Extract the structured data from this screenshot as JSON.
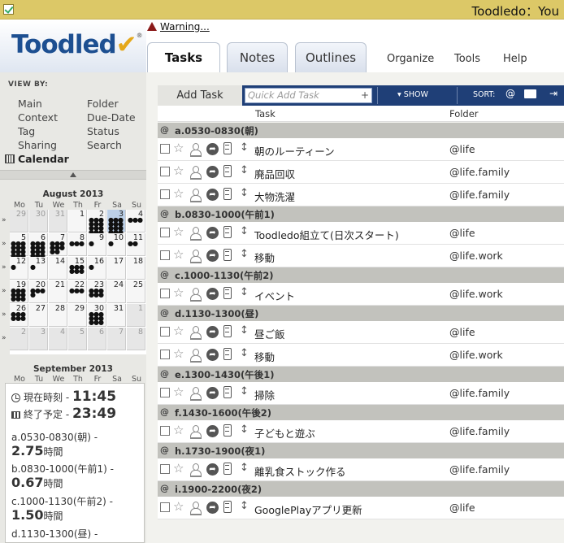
{
  "window": {
    "title": "Toodledo：You"
  },
  "logo": {
    "text": "Toodled",
    "check": "✔",
    "reg": "®"
  },
  "warning": {
    "label": "Warning..."
  },
  "tabs": [
    {
      "label": "Tasks",
      "active": true
    },
    {
      "label": "Notes",
      "active": false
    },
    {
      "label": "Outlines",
      "active": false
    }
  ],
  "nav": [
    "Organize",
    "Tools",
    "Help"
  ],
  "viewby": {
    "title": "VIEW BY:",
    "left": [
      "Main",
      "Context",
      "Tag",
      "Sharing",
      "Calendar"
    ],
    "right": [
      "Folder",
      "Due-Date",
      "Status",
      "Search"
    ]
  },
  "calendar": {
    "month1": "August 2013",
    "month2": "September 2013",
    "dow": [
      "Mo",
      "Tu",
      "We",
      "Th",
      "Fr",
      "Sa",
      "Su"
    ],
    "weeks": [
      [
        {
          "d": "29",
          "o": true,
          "dots": ""
        },
        {
          "d": "30",
          "o": true,
          "dots": ""
        },
        {
          "d": "31",
          "o": true,
          "dots": ""
        },
        {
          "d": "1",
          "o": false,
          "dots": ""
        },
        {
          "d": "2",
          "o": false,
          "dots": "●●●●●●●●●●●●"
        },
        {
          "d": "3",
          "o": false,
          "sel": true,
          "dots": "●●●●●●●●●●●●"
        },
        {
          "d": "4",
          "o": false,
          "dots": "●●●"
        }
      ],
      [
        {
          "d": "5",
          "o": false,
          "dots": "●●●●●●●●●●●●"
        },
        {
          "d": "6",
          "o": false,
          "dots": "●●●●●●●●●●●●"
        },
        {
          "d": "7",
          "o": false,
          "dots": "●●●●●●●●"
        },
        {
          "d": "8",
          "o": false,
          "dots": "●●●"
        },
        {
          "d": "9",
          "o": false,
          "dots": "●"
        },
        {
          "d": "10",
          "o": false,
          "dots": "●"
        },
        {
          "d": "11",
          "o": false,
          "dots": "●●"
        }
      ],
      [
        {
          "d": "12",
          "o": false,
          "dots": "●"
        },
        {
          "d": "13",
          "o": false,
          "dots": "●"
        },
        {
          "d": "14",
          "o": false,
          "dots": ""
        },
        {
          "d": "15",
          "o": false,
          "dots": "●●●●●●"
        },
        {
          "d": "16",
          "o": false,
          "dots": "●"
        },
        {
          "d": "17",
          "o": false,
          "dots": ""
        },
        {
          "d": "18",
          "o": false,
          "dots": ""
        }
      ],
      [
        {
          "d": "19",
          "o": false,
          "dots": "●●●●●●●●●"
        },
        {
          "d": "20",
          "o": false,
          "dots": "●●●●"
        },
        {
          "d": "21",
          "o": false,
          "dots": ""
        },
        {
          "d": "22",
          "o": false,
          "dots": "●●●"
        },
        {
          "d": "23",
          "o": false,
          "dots": "●●●●●●"
        },
        {
          "d": "24",
          "o": false,
          "dots": ""
        },
        {
          "d": "25",
          "o": false,
          "dots": ""
        }
      ],
      [
        {
          "d": "26",
          "o": false,
          "dots": "●●●●●●"
        },
        {
          "d": "27",
          "o": false,
          "dots": ""
        },
        {
          "d": "28",
          "o": false,
          "dots": ""
        },
        {
          "d": "29",
          "o": false,
          "dots": ""
        },
        {
          "d": "30",
          "o": false,
          "dots": "●●●●●●●●●"
        },
        {
          "d": "31",
          "o": false,
          "dots": ""
        },
        {
          "d": "1",
          "o": true,
          "dots": ""
        }
      ],
      [
        {
          "d": "2",
          "o": true,
          "dots": ""
        },
        {
          "d": "3",
          "o": true,
          "dots": ""
        },
        {
          "d": "4",
          "o": true,
          "dots": ""
        },
        {
          "d": "5",
          "o": true,
          "dots": ""
        },
        {
          "d": "6",
          "o": true,
          "dots": ""
        },
        {
          "d": "7",
          "o": true,
          "dots": ""
        },
        {
          "d": "8",
          "o": true,
          "dots": ""
        }
      ]
    ]
  },
  "timepanel": {
    "now_label": "現在時刻 - ",
    "now_value": "11:45",
    "end_label": "終了予定 - ",
    "end_value": "23:49",
    "unit": "時間",
    "blocks": [
      {
        "label": "a.0530-0830(朝) -",
        "hours": "2.75"
      },
      {
        "label": "b.0830-1000(午前1) -",
        "hours": "0.67"
      },
      {
        "label": "c.1000-1130(午前2) -",
        "hours": "1.50"
      },
      {
        "label": "d.1130-1300(昼) -",
        "hours": ""
      }
    ]
  },
  "toolbar": {
    "add_task": "Add Task",
    "quick_add_placeholder": "Quick Add Task",
    "plus": "+",
    "show": "▾ SHOW",
    "sort": "SORT:"
  },
  "columns": {
    "task": "Task",
    "folder": "Folder"
  },
  "groups": [
    {
      "label": "a.0530-0830(朝)",
      "tasks": [
        {
          "name": "朝のルーティーン",
          "folder": "@life"
        },
        {
          "name": "廃品回収",
          "folder": "@life.family"
        },
        {
          "name": "大物洗濯",
          "folder": "@life.family"
        }
      ]
    },
    {
      "label": "b.0830-1000(午前1)",
      "tasks": [
        {
          "name": "Toodledo組立て(日次スタート)",
          "folder": "@life"
        },
        {
          "name": "移動",
          "folder": "@life.work"
        }
      ]
    },
    {
      "label": "c.1000-1130(午前2)",
      "tasks": [
        {
          "name": "イベント",
          "folder": "@life.work"
        }
      ]
    },
    {
      "label": "d.1130-1300(昼)",
      "tasks": [
        {
          "name": "昼ご飯",
          "folder": "@life"
        },
        {
          "name": "移動",
          "folder": "@life.work"
        }
      ]
    },
    {
      "label": "e.1300-1430(午後1)",
      "tasks": [
        {
          "name": "掃除",
          "folder": "@life.family"
        }
      ]
    },
    {
      "label": "f.1430-1600(午後2)",
      "tasks": [
        {
          "name": "子どもと遊ぶ",
          "folder": "@life.family"
        }
      ]
    },
    {
      "label": "h.1730-1900(夜1)",
      "tasks": [
        {
          "name": "離乳食ストック作る",
          "folder": "@life.family"
        }
      ]
    },
    {
      "label": "i.1900-2200(夜2)",
      "tasks": [
        {
          "name": "GooglePlayアプリ更新",
          "folder": "@life"
        }
      ]
    }
  ]
}
